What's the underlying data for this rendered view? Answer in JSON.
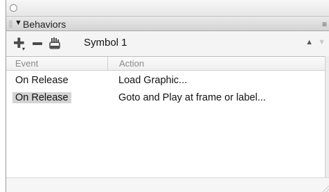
{
  "panel": {
    "title": "Behaviors",
    "collapse_icon": "▼",
    "options_icon": "≡"
  },
  "toolbar": {
    "add_icon": "plus-icon",
    "remove_icon": "minus-icon",
    "hand_icon": "hand-icon",
    "symbol_name": "Symbol 1",
    "up_icon": "▲",
    "down_icon": "▼"
  },
  "table": {
    "columns": [
      "Event",
      "Action"
    ],
    "rows": [
      {
        "event": "On Release",
        "action": "Load Graphic..."
      },
      {
        "event": "On Release",
        "action": "Goto and Play at frame or label..."
      }
    ],
    "selected_row": 1
  },
  "colors": {
    "panel_bg": "#f4f4f4",
    "header_bg": "#d3d3d3",
    "selection_bg": "#d4d4d4"
  }
}
